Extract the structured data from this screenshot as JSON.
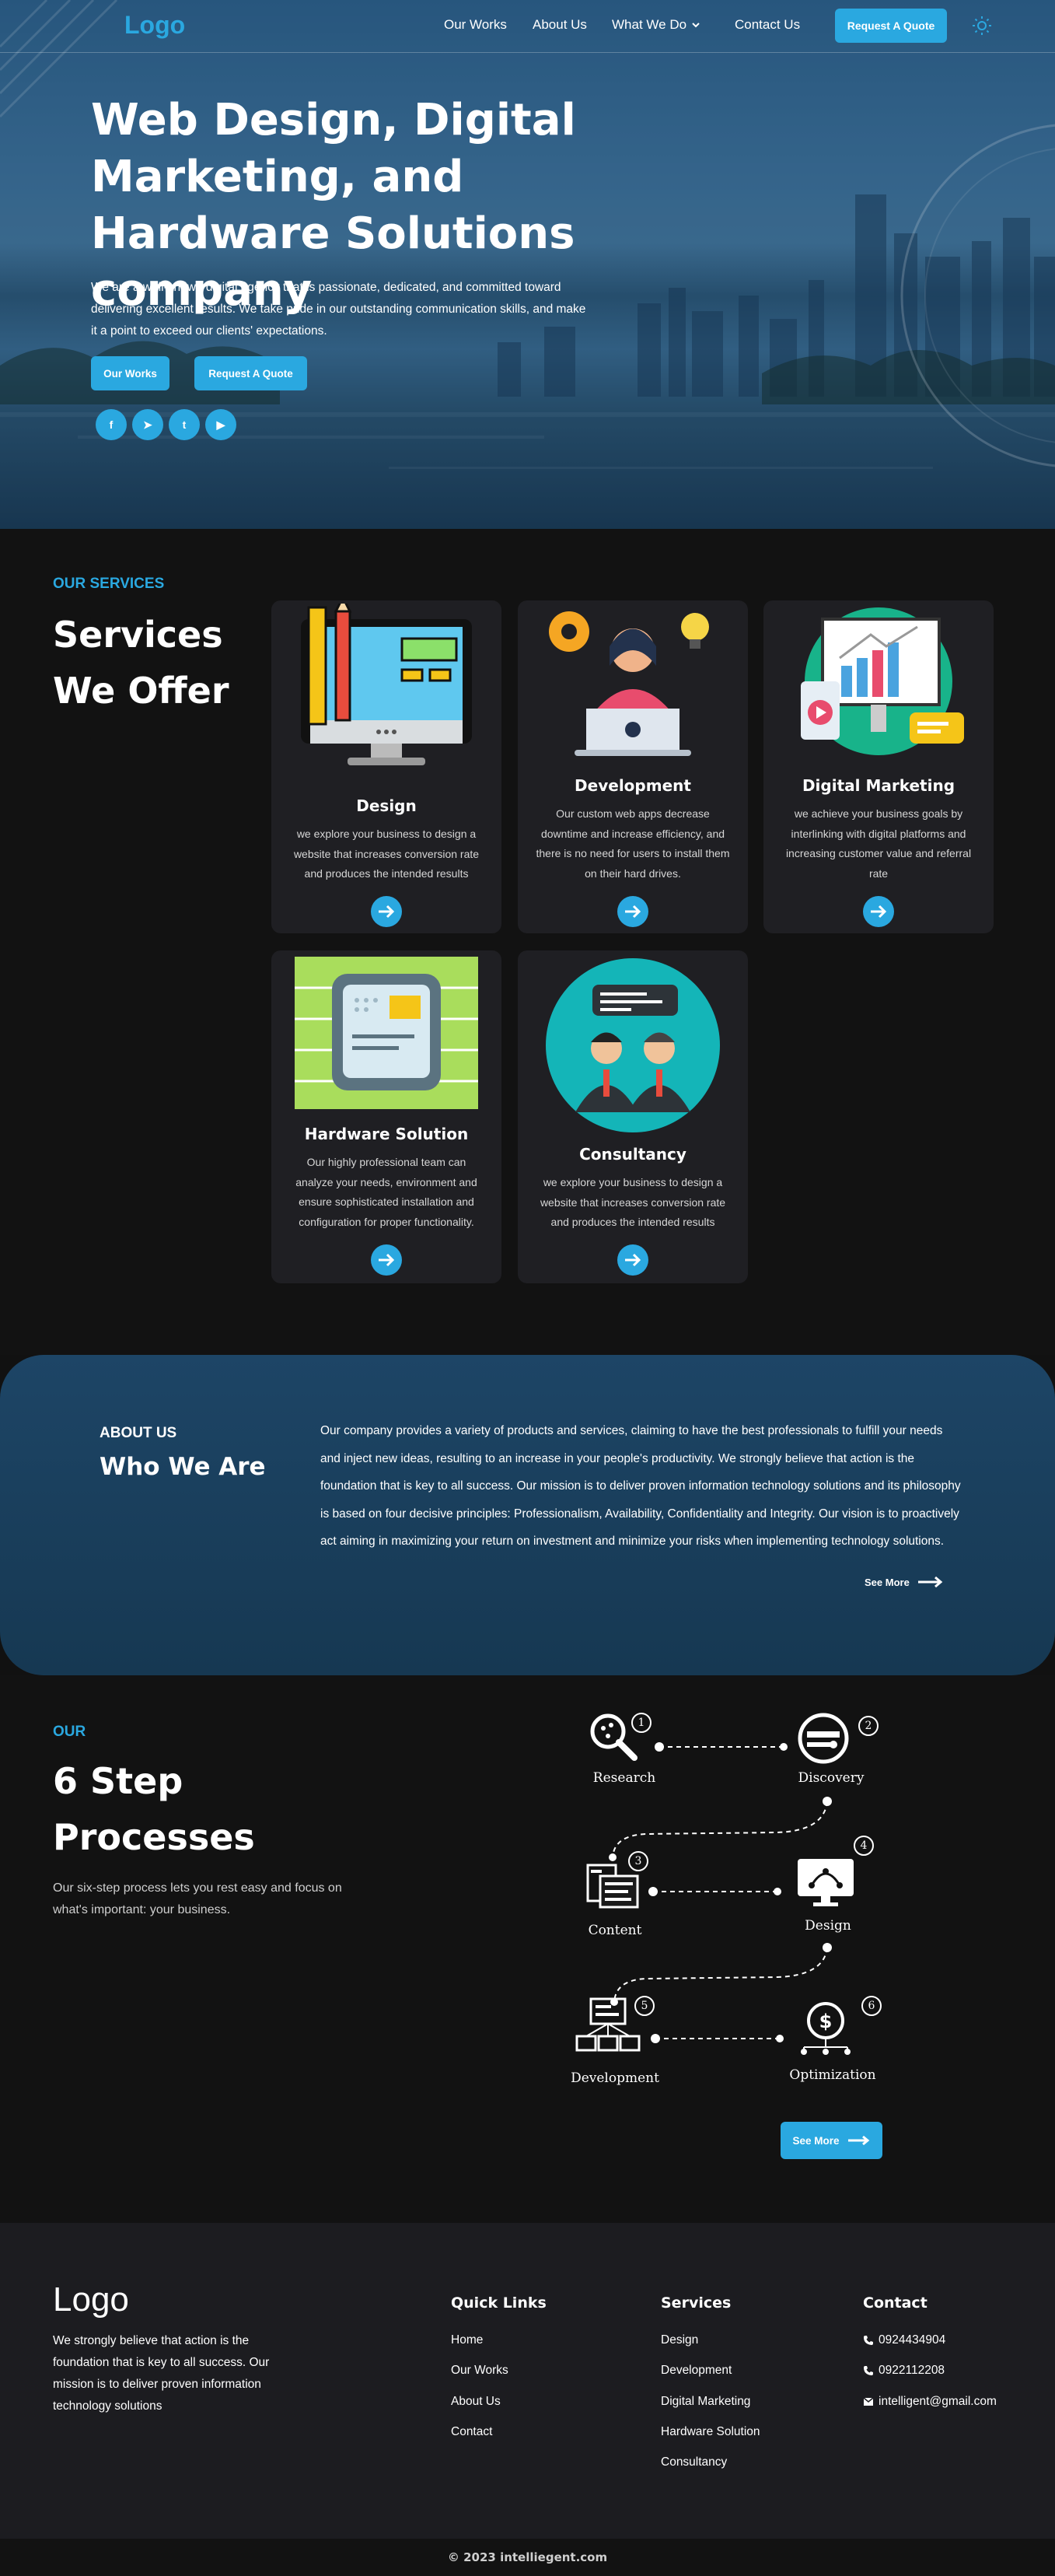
{
  "nav": {
    "logo": "Logo",
    "links": [
      "Our Works",
      "About Us",
      "What We Do",
      "Contact Us"
    ],
    "quote_button": "Request A Quote",
    "theme_icon": "sun-icon"
  },
  "hero": {
    "title": "Web Design, Digital Marketing, and Hardware Solutions company",
    "description": "We are a well-known digital agency that is passionate, dedicated, and committed toward delivering excellent results. We take pride in our outstanding communication skills, and make it a point to exceed our clients' expectations.",
    "buttons": [
      "Our Works",
      "Request A Quote"
    ],
    "socials": [
      {
        "icon": "facebook-icon",
        "glyph": "f"
      },
      {
        "icon": "telegram-icon",
        "glyph": "➤"
      },
      {
        "icon": "twitter-icon",
        "glyph": "t"
      },
      {
        "icon": "youtube-icon",
        "glyph": "▶"
      }
    ]
  },
  "services": {
    "eyebrow": "OUR SERVICES",
    "heading_line1": "Services",
    "heading_line2": "We Offer",
    "cards": [
      {
        "title": "Design",
        "description": "we explore your business to design a website that increases conversion rate and produces the intended results"
      },
      {
        "title": "Development",
        "description": "Our custom web apps decrease downtime and increase efficiency, and there is no need for users to install them on their hard drives."
      },
      {
        "title": "Digital Marketing",
        "description": "we achieve your business goals by interlinking with digital platforms and increasing customer value and referral rate"
      },
      {
        "title": "Hardware Solution",
        "description": "Our highly professional team can analyze your needs, environment and ensure sophisticated installation and configuration for proper functionality."
      },
      {
        "title": "Consultancy",
        "description": "we explore your business to design a website that increases conversion rate and produces the intended results"
      }
    ]
  },
  "about": {
    "eyebrow": "ABOUT US",
    "heading": "Who We Are",
    "text": "Our company provides a variety of products and services, claiming to have the best professionals to fulfill your needs and inject new ideas, resulting to an increase in your people's productivity. We strongly believe that action is the foundation that is  key to all success. Our mission is to deliver proven information technology solutions and its philosophy is based on four decisive principles: Professionalism, Availability, Confidentiality and Integrity. Our vision is to proactively act aiming in maximizing your return on investment and minimize your risks when implementing technology solutions.",
    "see_more": "See More"
  },
  "process": {
    "eyebrow": "OUR",
    "heading_line1": "6 Step",
    "heading_line2": "Processes",
    "description": "Our six-step process lets you rest easy and focus on what's important: your business.",
    "steps": [
      {
        "num": "1",
        "label": "Research"
      },
      {
        "num": "2",
        "label": "Discovery"
      },
      {
        "num": "3",
        "label": "Content"
      },
      {
        "num": "4",
        "label": "Design"
      },
      {
        "num": "5",
        "label": "Development"
      },
      {
        "num": "6",
        "label": "Optimization"
      }
    ],
    "see_more": "See More"
  },
  "footer": {
    "logo": "Logo",
    "about": "We strongly believe that action is the foundation that is  key to all success. Our mission is to deliver proven information technology solutions",
    "quick_links_title": "Quick Links",
    "quick_links": [
      "Home",
      "Our Works",
      "About Us",
      "Contact"
    ],
    "services_title": "Services",
    "services": [
      "Design",
      "Development",
      "Digital Marketing",
      "Hardware Solution",
      "Consultancy"
    ],
    "contact_title": "Contact",
    "contacts": [
      {
        "icon": "phone-icon",
        "text": "0924434904"
      },
      {
        "icon": "phone-icon",
        "text": "0922112208"
      },
      {
        "icon": "mail-icon",
        "text": "intelligent@gmail.com"
      }
    ],
    "copyright": "© 2023 intelliegent.com"
  },
  "colors": {
    "accent": "#2aa8e0",
    "background": "#121212",
    "card": "#1f1f23",
    "about_bg": "#1d4566"
  }
}
